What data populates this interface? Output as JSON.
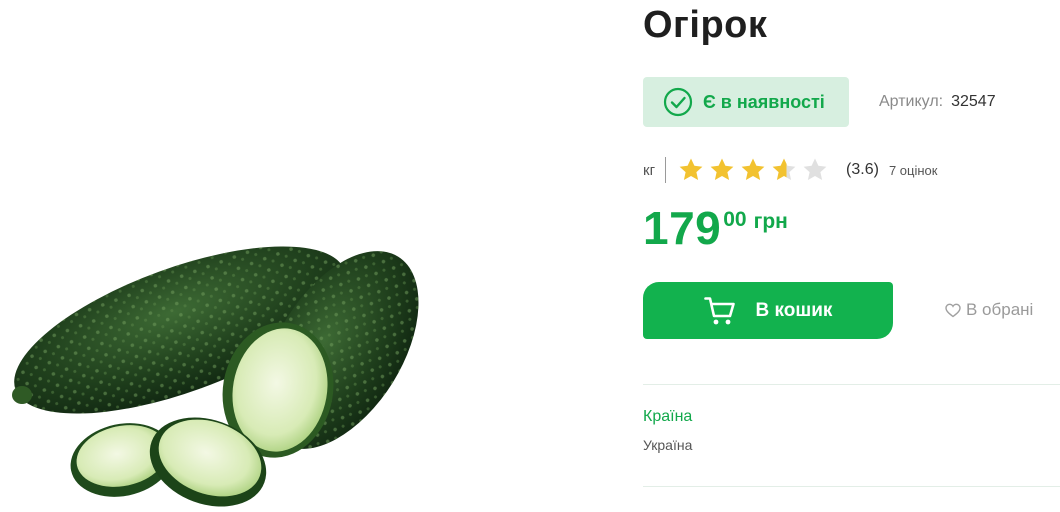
{
  "product": {
    "title": "Огірок",
    "image_alt": "cucumber",
    "stock": {
      "text": "Є в наявності",
      "icon": "check-circle-icon",
      "color": "#12a84b",
      "bg": "#d7efe0"
    },
    "sku": {
      "label": "Артикул:",
      "value": "32547"
    },
    "unit": "кг",
    "rating": {
      "value": 3.6,
      "text": "(3.6)",
      "reviews": "7 оцінок",
      "max": 5
    },
    "price": {
      "whole": "179",
      "fraction": "00",
      "currency": "грн"
    },
    "actions": {
      "cart_label": "В кошик",
      "cart_icon": "shopping-cart-icon",
      "favorite_label": "В обрані",
      "favorite_icon": "heart-icon"
    },
    "specs": [
      {
        "label": "Країна",
        "value": "Україна"
      }
    ]
  },
  "colors": {
    "accent": "#12b24e",
    "star": "#f2c230",
    "star_empty": "#e0e0e0"
  }
}
